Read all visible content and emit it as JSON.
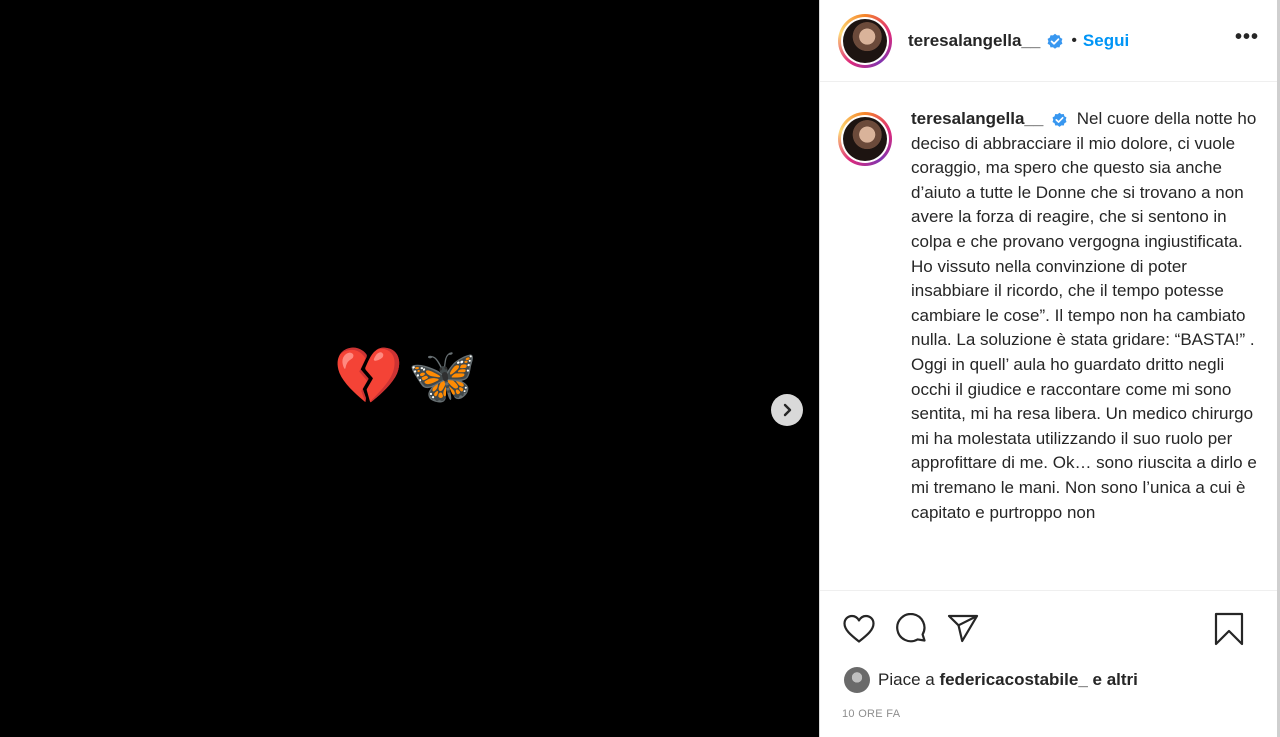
{
  "media": {
    "emoji_1": "💔",
    "emoji_2": "🦋"
  },
  "header": {
    "username": "teresalangella__",
    "separator": "•",
    "follow_label": "Segui",
    "more_label": "•••"
  },
  "caption": {
    "username": "teresalangella__",
    "text": "Nel cuore della notte ho deciso di abbracciare il mio dolore, ci vuole coraggio, ma spero che questo sia anche d’aiuto a tutte le Donne che si trovano a non avere la forza di reagire, che si sentono in colpa e che provano vergogna ingiustificata. Ho vissuto nella convinzione di poter insabbiare il ricordo, che il tempo potesse cambiare le cose”. Il tempo non ha cambiato nulla. La soluzione è stata gridare: “BASTA!” . Oggi in quell’ aula ho guardato dritto negli occhi il giudice e raccontare come mi sono sentita, mi ha resa libera. Un medico chirurgo mi ha molestata utilizzando il suo ruolo per approfittare di me. Ok… sono riuscita a dirlo e mi tremano le mani. Non sono l’unica a cui è capitato e purtroppo non"
  },
  "likes": {
    "prefix": "Piace a",
    "user": "federicacostabile_",
    "suffix": "e altri"
  },
  "timestamp": "10 ORE FA",
  "colors": {
    "accent": "#0095f6",
    "verified": "#3897f0",
    "text": "#262626",
    "muted": "#8e8e8e"
  }
}
